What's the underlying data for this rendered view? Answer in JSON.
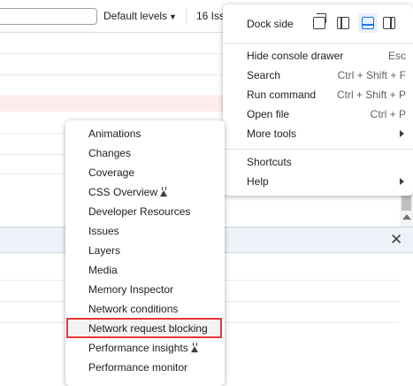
{
  "toolbar": {
    "levels_label": "Default levels",
    "issues_label": "16 Iss"
  },
  "main_menu": {
    "dock_label": "Dock side",
    "dock_options": [
      "undock-into-separate-window-icon",
      "dock-to-left-icon",
      "dock-to-bottom-icon",
      "dock-to-right-icon"
    ],
    "dock_selected": "dock-to-bottom-icon",
    "items": [
      {
        "label": "Hide console drawer",
        "shortcut": "Esc"
      },
      {
        "label": "Search",
        "shortcut": "Ctrl + Shift + F"
      },
      {
        "label": "Run command",
        "shortcut": "Ctrl + Shift + P"
      },
      {
        "label": "Open file",
        "shortcut": "Ctrl + P"
      },
      {
        "label": "More tools",
        "shortcut": ""
      },
      {
        "label": "Shortcuts",
        "shortcut": ""
      },
      {
        "label": "Help",
        "shortcut": ""
      }
    ]
  },
  "more_tools": {
    "items": [
      {
        "label": "Animations"
      },
      {
        "label": "Changes"
      },
      {
        "label": "Coverage"
      },
      {
        "label": "CSS Overview",
        "icon": "flask-icon"
      },
      {
        "label": "Developer Resources"
      },
      {
        "label": "Issues"
      },
      {
        "label": "Layers"
      },
      {
        "label": "Media"
      },
      {
        "label": "Memory Inspector"
      },
      {
        "label": "Network conditions"
      },
      {
        "label": "Network request blocking"
      },
      {
        "label": "Performance insights",
        "icon": "flask-icon"
      },
      {
        "label": "Performance monitor"
      }
    ],
    "highlighted": "Network request blocking"
  },
  "colors": {
    "highlight_border": "#e53935",
    "dock_selected": "#1a73e8",
    "error_row": "#fdeeee",
    "drawer_header": "#eef2f9"
  }
}
